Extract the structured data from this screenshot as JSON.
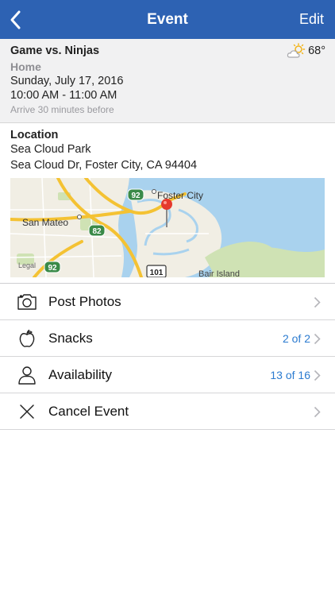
{
  "nav": {
    "title": "Event",
    "edit_label": "Edit",
    "back_icon": "chevron-left-icon"
  },
  "event": {
    "name": "Game vs. Ninjas",
    "home_away": "Home",
    "date": "Sunday, July 17, 2016",
    "time": "10:00 AM - 11:00 AM",
    "arrive": "Arrive 30 minutes before",
    "weather": {
      "icon": "partly-cloudy-icon",
      "temp": "68°"
    }
  },
  "location": {
    "label": "Location",
    "name": "Sea Cloud Park",
    "address": "Sea Cloud Dr, Foster City, CA 94404",
    "map": {
      "labels": {
        "foster_city": "Foster City",
        "san_mateo": "San Mateo",
        "bair_island": "Bair Island",
        "legal": "Legal"
      },
      "shields": {
        "hwy92_a": "92",
        "hwy92_b": "92",
        "hwy82": "82",
        "us101": "101"
      },
      "colors": {
        "water": "#a9d2ee",
        "land": "#f1eee4",
        "road": "#f4c233",
        "park": "#cfe2b4",
        "pin": "#e53a2e"
      }
    }
  },
  "menu": {
    "items": [
      {
        "label": "Post Photos",
        "count": "",
        "icon": "camera-icon"
      },
      {
        "label": "Snacks",
        "count": "2 of 2",
        "icon": "apple-icon"
      },
      {
        "label": "Availability",
        "count": "13 of 16",
        "icon": "person-icon"
      },
      {
        "label": "Cancel Event",
        "count": "",
        "icon": "close-icon"
      }
    ]
  },
  "colors": {
    "nav_bg": "#2d62b3",
    "accent": "#2b7bd0",
    "info_bg": "#f1f1f2"
  }
}
